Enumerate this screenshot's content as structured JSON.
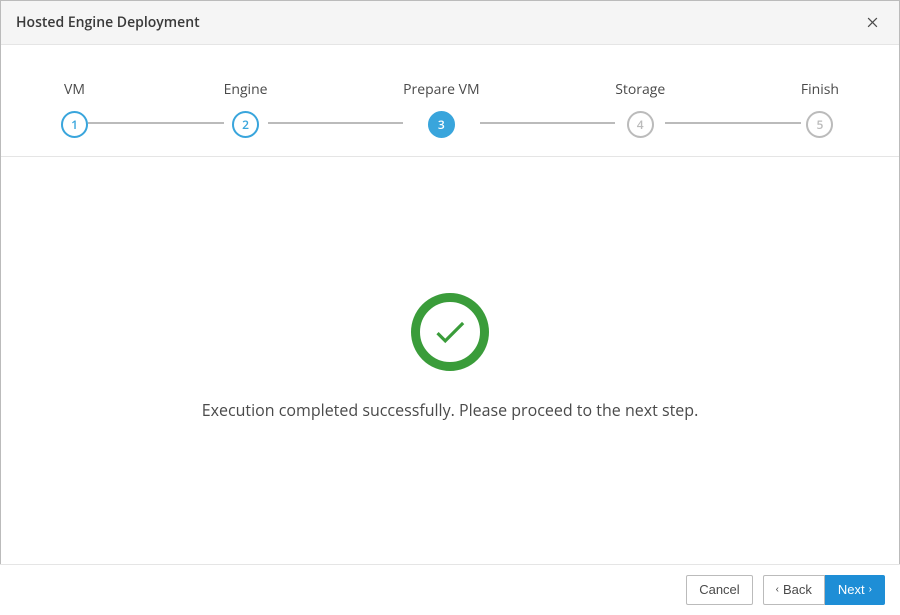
{
  "header": {
    "title": "Hosted Engine Deployment"
  },
  "stepper": {
    "steps": [
      {
        "label": "VM",
        "num": "1",
        "state": "done"
      },
      {
        "label": "Engine",
        "num": "2",
        "state": "done"
      },
      {
        "label": "Prepare VM",
        "num": "3",
        "state": "active"
      },
      {
        "label": "Storage",
        "num": "4",
        "state": "future"
      },
      {
        "label": "Finish",
        "num": "5",
        "state": "future"
      }
    ]
  },
  "content": {
    "status_message": "Execution completed successfully. Please proceed to the next step."
  },
  "footer": {
    "cancel_label": "Cancel",
    "back_label": "Back",
    "next_label": "Next"
  },
  "colors": {
    "accent": "#39a5dc",
    "success": "#3a9c3a"
  }
}
